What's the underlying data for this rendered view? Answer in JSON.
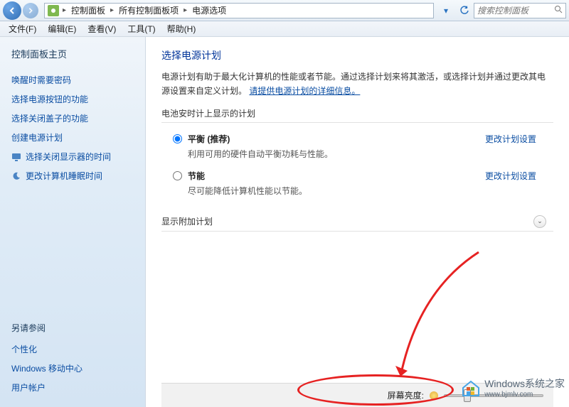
{
  "addressbar": {
    "crumbs": [
      "控制面板",
      "所有控制面板项",
      "电源选项"
    ],
    "search_placeholder": "搜索控制面板"
  },
  "menubar": {
    "items": [
      "文件(F)",
      "编辑(E)",
      "查看(V)",
      "工具(T)",
      "帮助(H)"
    ]
  },
  "sidebar": {
    "home": "控制面板主页",
    "links": [
      "唤醒时需要密码",
      "选择电源按钮的功能",
      "选择关闭盖子的功能",
      "创建电源计划",
      "选择关闭显示器的时间",
      "更改计算机睡眠时间"
    ],
    "see_also_label": "另请参阅",
    "see_also": [
      "个性化",
      "Windows 移动中心",
      "用户帐户"
    ]
  },
  "content": {
    "title": "选择电源计划",
    "desc_before": "电源计划有助于最大化计算机的性能或者节能。通过选择计划来将其激活，或选择计划并通过更改其电源设置来自定义计划。",
    "desc_link": "请提供电源计划的详细信息。",
    "plans_label": "电池安时计上显示的计划",
    "plans": [
      {
        "name": "平衡 (推荐)",
        "sub": "利用可用的硬件自动平衡功耗与性能。",
        "change": "更改计划设置",
        "checked": true
      },
      {
        "name": "节能",
        "sub": "尽可能降低计算机性能以节能。",
        "change": "更改计划设置",
        "checked": false
      }
    ],
    "expander_label": "显示附加计划",
    "brightness_label": "屏幕亮度:"
  },
  "watermark": {
    "line1": "Windows系统之家",
    "line2": "www.bjmlv.com"
  }
}
